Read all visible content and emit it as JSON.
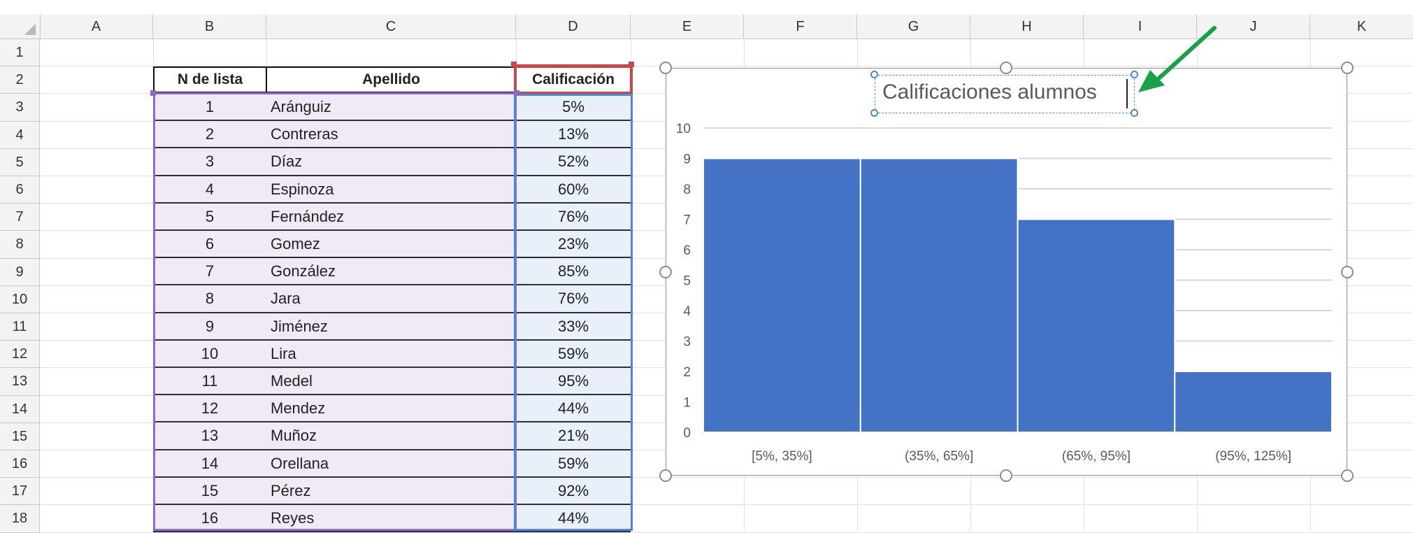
{
  "columns": [
    "A",
    "B",
    "C",
    "D",
    "E",
    "F",
    "G",
    "H",
    "I",
    "J",
    "K"
  ],
  "rows": [
    "1",
    "2",
    "3",
    "4",
    "5",
    "6",
    "7",
    "8",
    "9",
    "10",
    "11",
    "12",
    "13",
    "14",
    "15",
    "16",
    "17",
    "18"
  ],
  "table": {
    "headers": {
      "num": "N de lista",
      "name": "Apellido",
      "grade": "Calificación"
    },
    "rows": [
      {
        "num": "1",
        "name": "Aránguiz",
        "grade": "5%"
      },
      {
        "num": "2",
        "name": "Contreras",
        "grade": "13%"
      },
      {
        "num": "3",
        "name": "Díaz",
        "grade": "52%"
      },
      {
        "num": "4",
        "name": "Espinoza",
        "grade": "60%"
      },
      {
        "num": "5",
        "name": "Fernández",
        "grade": "76%"
      },
      {
        "num": "6",
        "name": "Gomez",
        "grade": "23%"
      },
      {
        "num": "7",
        "name": "González",
        "grade": "85%"
      },
      {
        "num": "8",
        "name": "Jara",
        "grade": "76%"
      },
      {
        "num": "9",
        "name": "Jiménez",
        "grade": "33%"
      },
      {
        "num": "10",
        "name": "Lira",
        "grade": "59%"
      },
      {
        "num": "11",
        "name": "Medel",
        "grade": "95%"
      },
      {
        "num": "12",
        "name": "Mendez",
        "grade": "44%"
      },
      {
        "num": "13",
        "name": "Muñoz",
        "grade": "21%"
      },
      {
        "num": "14",
        "name": "Orellana",
        "grade": "59%"
      },
      {
        "num": "15",
        "name": "Pérez",
        "grade": "92%"
      },
      {
        "num": "16",
        "name": "Reyes",
        "grade": "44%"
      }
    ]
  },
  "colors": {
    "bar": "#4472c4",
    "arrow": "#1aa046",
    "selection_purple": "#8b6ac8",
    "selection_red": "#d0454c",
    "selection_blue": "#4d86d6"
  },
  "chart_data": {
    "type": "bar",
    "title": "Calificaciones alumnos",
    "categories": [
      "[5%, 35%]",
      "(35%, 65%]",
      "(65%, 95%]",
      "(95%, 125%]"
    ],
    "values": [
      9,
      9,
      7,
      2
    ],
    "ylim": [
      0,
      10
    ],
    "yticks": [
      "0",
      "1",
      "2",
      "3",
      "4",
      "5",
      "6",
      "7",
      "8",
      "9",
      "10"
    ],
    "grid": true,
    "legend": "none"
  }
}
